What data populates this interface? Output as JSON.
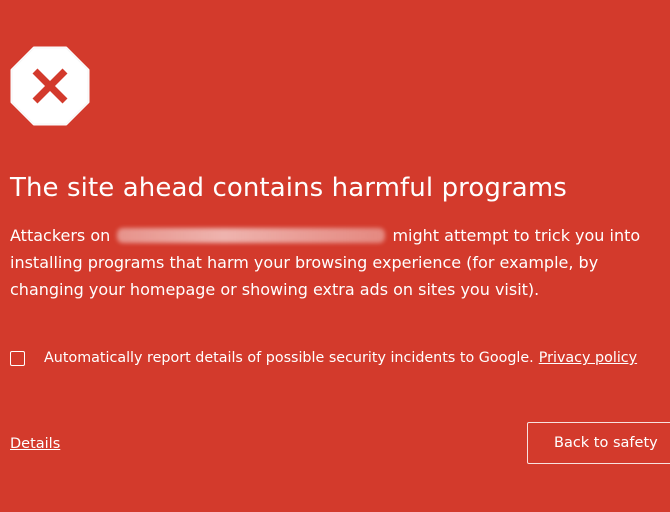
{
  "colors": {
    "background": "#d33a2c",
    "text": "#ffffff",
    "icon_fill": "#ffffff",
    "icon_x": "#d33a2c"
  },
  "icon": "octagon-x-icon",
  "heading": "The site ahead contains harmful programs",
  "body": {
    "prefix": "Attackers on",
    "redacted_site": "",
    "suffix": "might attempt to trick you into installing programs that harm your browsing experience (for example, by changing your homepage or showing extra ads on sites you visit)."
  },
  "report": {
    "checked": false,
    "label": "Automatically report details of possible security incidents to Google.",
    "privacy_link": "Privacy policy"
  },
  "footer": {
    "details_link": "Details",
    "back_button": "Back to safety"
  }
}
